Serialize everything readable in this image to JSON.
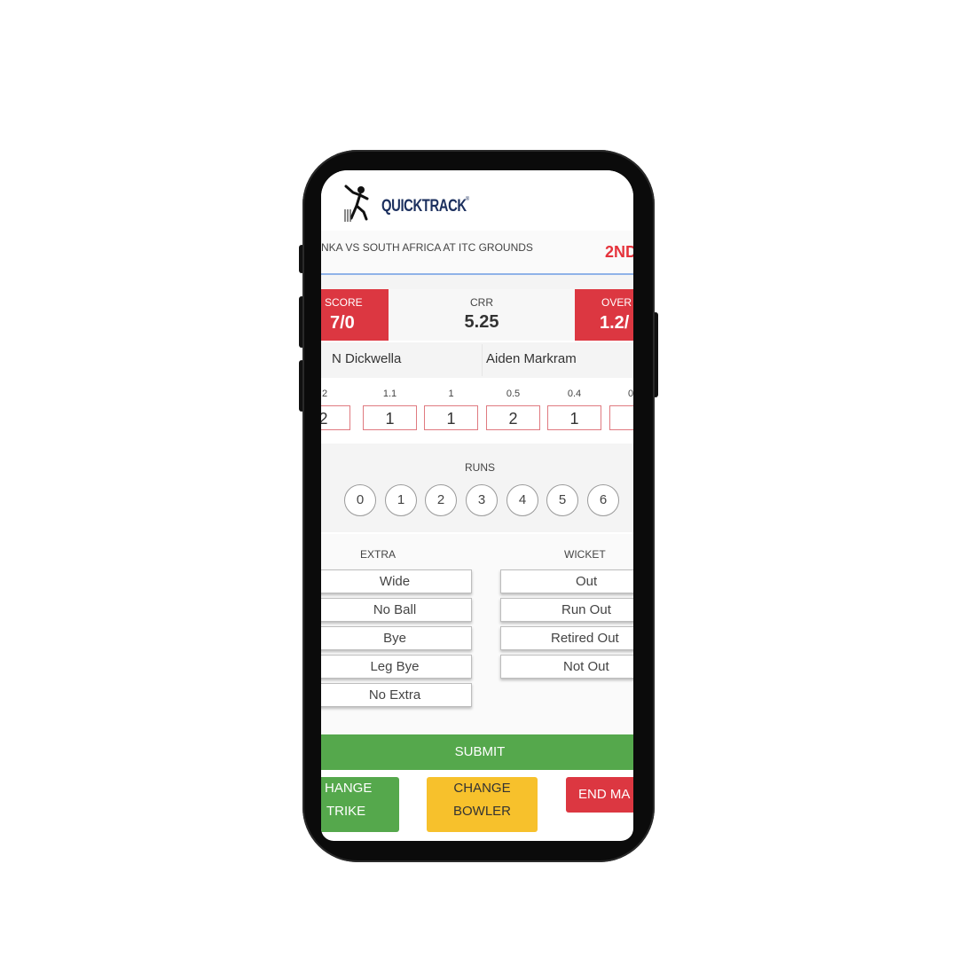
{
  "brand": {
    "name": "QUICKTRACK"
  },
  "match": {
    "title": "NKA VS SOUTH AFRICA AT ITC GROUNDS",
    "innings": "2ND"
  },
  "scoreboard": {
    "score_label": "SCORE",
    "score_value": "7/0",
    "crr_label": "CRR",
    "crr_value": "5.25",
    "overs_label": "OVER",
    "overs_value": "1.2/"
  },
  "players": {
    "batsman_1": "N Dickwella",
    "batsman_2": "Aiden Markram"
  },
  "recent_balls": [
    {
      "over": ".2",
      "runs": "2"
    },
    {
      "over": "1.1",
      "runs": "1"
    },
    {
      "over": "1",
      "runs": "1"
    },
    {
      "over": "0.5",
      "runs": "2"
    },
    {
      "over": "0.4",
      "runs": "1"
    },
    {
      "over": "0",
      "runs": ""
    }
  ],
  "runs": {
    "label": "RUNS",
    "options": [
      "0",
      "1",
      "2",
      "3",
      "4",
      "5",
      "6"
    ]
  },
  "extra": {
    "label": "EXTRA",
    "options": [
      "Wide",
      "No Ball",
      "Bye",
      "Leg Bye",
      "No Extra"
    ]
  },
  "wicket": {
    "label": "WICKET",
    "options": [
      "Out",
      "Run Out",
      "Retired Out",
      "Not Out"
    ]
  },
  "actions": {
    "submit": "SUBMIT",
    "change_strike_line1": "HANGE",
    "change_strike_line2": "TRIKE",
    "change_bowler_line1": "CHANGE",
    "change_bowler_line2": "BOWLER",
    "end_match": "END MA"
  },
  "colors": {
    "red": "#dc3741",
    "green": "#55a84c",
    "yellow": "#f7c12c",
    "navy": "#1b2f5e"
  }
}
